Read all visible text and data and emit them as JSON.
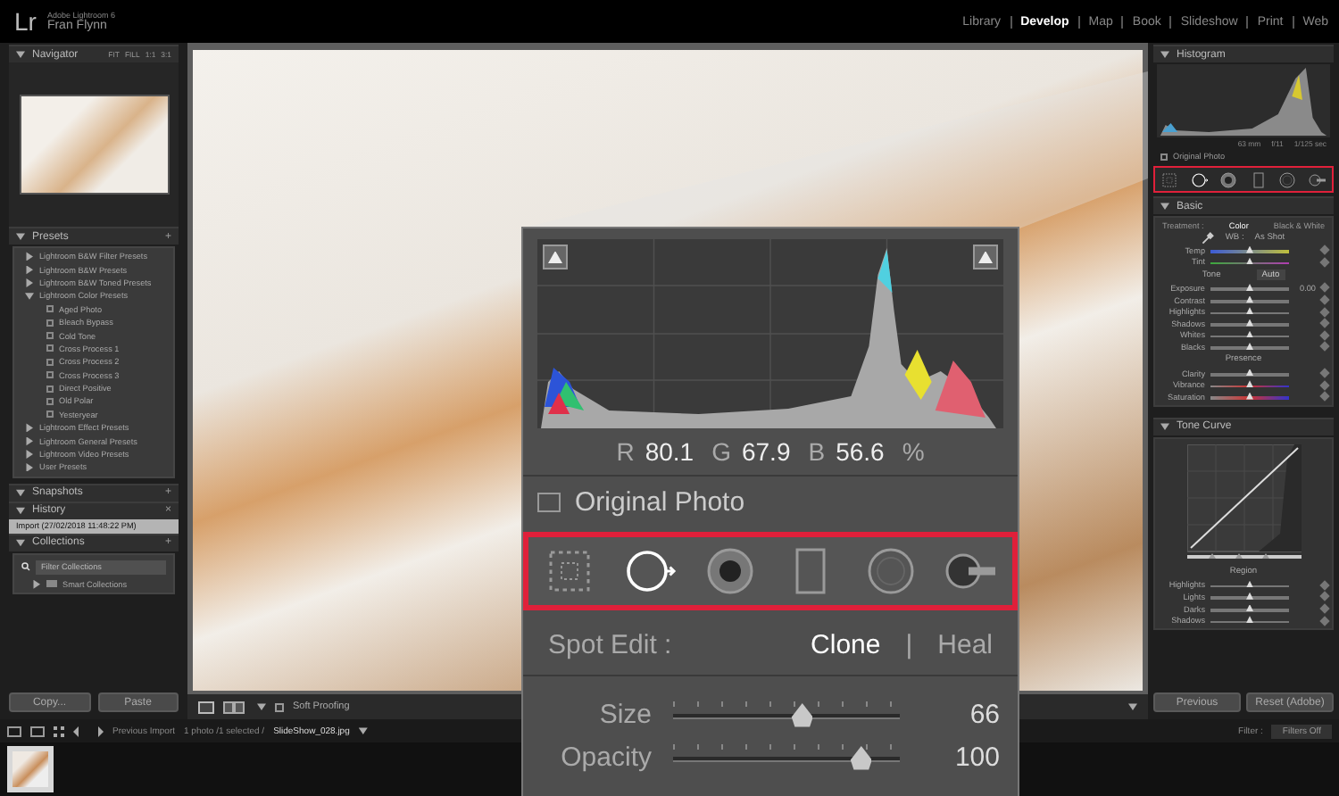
{
  "app": {
    "logo": "Lr",
    "product": "Adobe Lightroom 6",
    "user": "Fran Flynn"
  },
  "modules": [
    {
      "label": "Library",
      "selected": false
    },
    {
      "label": "Develop",
      "selected": true
    },
    {
      "label": "Map",
      "selected": false
    },
    {
      "label": "Book",
      "selected": false
    },
    {
      "label": "Slideshow",
      "selected": false
    },
    {
      "label": "Print",
      "selected": false
    },
    {
      "label": "Web",
      "selected": false
    }
  ],
  "left_panel": {
    "navigator": {
      "title": "Navigator",
      "expanded": true,
      "zoom_options": [
        "FIT",
        "FILL",
        "1:1",
        "3:1"
      ]
    },
    "presets": {
      "title": "Presets",
      "expanded": true,
      "add": "+",
      "items": [
        {
          "label": "Lightroom B&W Filter Presets",
          "expanded": false
        },
        {
          "label": "Lightroom B&W Presets",
          "expanded": false
        },
        {
          "label": "Lightroom B&W Toned Presets",
          "expanded": false
        },
        {
          "label": "Lightroom Color Presets",
          "expanded": true,
          "children": [
            {
              "label": "Aged Photo"
            },
            {
              "label": "Bleach Bypass"
            },
            {
              "label": "Cold Tone"
            },
            {
              "label": "Cross Process 1"
            },
            {
              "label": "Cross Process 2"
            },
            {
              "label": "Cross Process 3"
            },
            {
              "label": "Direct Positive"
            },
            {
              "label": "Old Polar"
            },
            {
              "label": "Yesteryear"
            }
          ]
        },
        {
          "label": "Lightroom Effect Presets",
          "expanded": false
        },
        {
          "label": "Lightroom General Presets",
          "expanded": false
        },
        {
          "label": "Lightroom Video Presets",
          "expanded": false
        },
        {
          "label": "User Presets",
          "expanded": false
        }
      ]
    },
    "snapshots": {
      "title": "Snapshots",
      "expanded": true,
      "add": "+"
    },
    "history": {
      "title": "History",
      "expanded": true,
      "clear": "×",
      "items": [
        {
          "label": "Import (27/02/2018 11:48:22 PM)",
          "selected": true
        }
      ]
    },
    "collections": {
      "title": "Collections",
      "expanded": true,
      "add": "+",
      "filter": {
        "placeholder": "Filter Collections"
      },
      "items": [
        {
          "label": "Smart Collections",
          "expanded": false
        }
      ]
    },
    "buttons": [
      "Copy...",
      "Paste"
    ]
  },
  "center": {
    "toolbar": {
      "soft_proofing": {
        "label": "Soft Proofing",
        "checked": false
      }
    }
  },
  "right_panel": {
    "histogram": {
      "title": "Histogram",
      "expanded": true,
      "exif": [
        "63 mm",
        "f/11",
        "1/125 sec"
      ],
      "original_photo": {
        "label": "Original Photo",
        "checked": false
      }
    },
    "tools": [
      {
        "kind": "crop",
        "selected": false
      },
      {
        "kind": "spot",
        "selected": true
      },
      {
        "kind": "redeye",
        "selected": false
      },
      {
        "kind": "graduated",
        "selected": false
      },
      {
        "kind": "radial",
        "selected": false
      },
      {
        "kind": "brush",
        "selected": false
      }
    ],
    "basic": {
      "title": "Basic",
      "expanded": true,
      "treatment_label": "Treatment :",
      "treatments": [
        {
          "label": "Color",
          "selected": true
        },
        {
          "label": "Black & White",
          "selected": false
        }
      ],
      "rows": [
        {
          "kind": "select",
          "label": "WB :",
          "value": "As Shot"
        },
        {
          "kind": "tempslider",
          "label": "Temp",
          "level": 0.5
        },
        {
          "kind": "tintslider",
          "label": "Tint",
          "level": 0.5
        },
        {
          "kind": "heading",
          "label": "Tone",
          "button": "Auto"
        },
        {
          "kind": "slider",
          "label": "Exposure",
          "level": 0.5,
          "value": "0.00"
        },
        {
          "kind": "slider",
          "label": "Contrast",
          "level": 0.5
        },
        {
          "kind": "slider",
          "label": "Highlights",
          "level": 0.5
        },
        {
          "kind": "slider",
          "label": "Shadows",
          "level": 0.5
        },
        {
          "kind": "slider",
          "label": "Whites",
          "level": 0.5
        },
        {
          "kind": "slider",
          "label": "Blacks",
          "level": 0.5
        },
        {
          "kind": "heading",
          "label": "Presence"
        },
        {
          "kind": "slider",
          "label": "Clarity",
          "level": 0.5
        },
        {
          "kind": "colorslider",
          "label": "Vibrance",
          "level": 0.5
        },
        {
          "kind": "colorslider",
          "label": "Saturation",
          "level": 0.5
        }
      ]
    },
    "tone_curve": {
      "title": "Tone Curve",
      "expanded": true,
      "region_label": "Region",
      "sliders": [
        {
          "label": "Highlights",
          "level": 0.5
        },
        {
          "label": "Lights",
          "level": 0.5
        },
        {
          "label": "Darks",
          "level": 0.5
        },
        {
          "label": "Shadows",
          "level": 0.5
        }
      ]
    },
    "buttons": [
      "Previous",
      "Reset (Adobe)"
    ]
  },
  "filmstrip": {
    "source": "Previous Import",
    "count": "1 photo /1 selected /",
    "file": "SlideShow_028.jpg",
    "filter_label": "Filter :",
    "filter_value": "Filters Off"
  },
  "popup": {
    "readout": [
      {
        "channel": "R",
        "value": "80.1"
      },
      {
        "channel": "G",
        "value": "67.9"
      },
      {
        "channel": "B",
        "value": "56.6"
      }
    ],
    "unit": "%",
    "original_photo": {
      "label": "Original Photo",
      "checked": false
    },
    "tools": [
      {
        "kind": "crop",
        "selected": false
      },
      {
        "kind": "spot",
        "selected": true
      },
      {
        "kind": "redeye",
        "selected": false
      },
      {
        "kind": "graduated",
        "selected": false
      },
      {
        "kind": "radial",
        "selected": false
      },
      {
        "kind": "brush",
        "selected": false
      }
    ],
    "spot_edit": {
      "label": "Spot Edit :",
      "separator": "|",
      "modes": [
        {
          "label": "Clone",
          "selected": true
        },
        {
          "label": "Heal",
          "selected": false
        }
      ]
    },
    "sliders": [
      {
        "label": "Size",
        "value": "66",
        "level": 0.57
      },
      {
        "label": "Opacity",
        "value": "100",
        "level": 0.83
      }
    ]
  }
}
